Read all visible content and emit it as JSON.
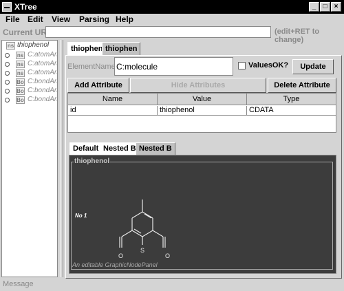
{
  "window": {
    "title": "XTree",
    "minimize": "_",
    "maximize": "□",
    "close": "×"
  },
  "menu": {
    "items": [
      "File",
      "Edit",
      "View",
      "Parsing",
      "Help"
    ]
  },
  "url": {
    "label": "Current URL:",
    "value": "",
    "hint": "(edit+RET to change)"
  },
  "tree": {
    "root": {
      "icon": "ns",
      "label": "thiophenol"
    },
    "items": [
      {
        "icon": "ns",
        "label": "C:atomArra"
      },
      {
        "icon": "ns",
        "label": "C:atomArra"
      },
      {
        "icon": "ns",
        "label": "C:atomArra"
      },
      {
        "icon": "Bo",
        "label": "C:bondArra"
      },
      {
        "icon": "Bo",
        "label": "C:bondArra"
      },
      {
        "icon": "Bo",
        "label": "C:bondArra"
      }
    ]
  },
  "top_tabs": [
    "thiophen",
    "thiophen"
  ],
  "element": {
    "name_label": "ElementName:",
    "name_value": "C:molecule",
    "values_ok_label": "ValuesOK?",
    "update_label": "Update"
  },
  "attr_buttons": {
    "add": "Add Attribute",
    "hide": "Hide Attributes",
    "delete": "Delete Attribute"
  },
  "table": {
    "headers": [
      "Name",
      "Value",
      "Type"
    ],
    "rows": [
      [
        "id",
        "thiophenol",
        "CDATA"
      ]
    ]
  },
  "bottom_tabs": [
    "Default",
    "Nested B",
    "Nested B"
  ],
  "graphic": {
    "title": "thiophenol",
    "node_label": "No 1",
    "caption": "An editable GraphicNodePanel",
    "atoms": {
      "left_o": "O",
      "s": "S",
      "right_o": "O"
    }
  },
  "status": {
    "message": "Message"
  },
  "colors": {
    "graphic_bg": "#3c3c3c",
    "titlebar": "#000000",
    "panel": "#d4d4d4"
  }
}
